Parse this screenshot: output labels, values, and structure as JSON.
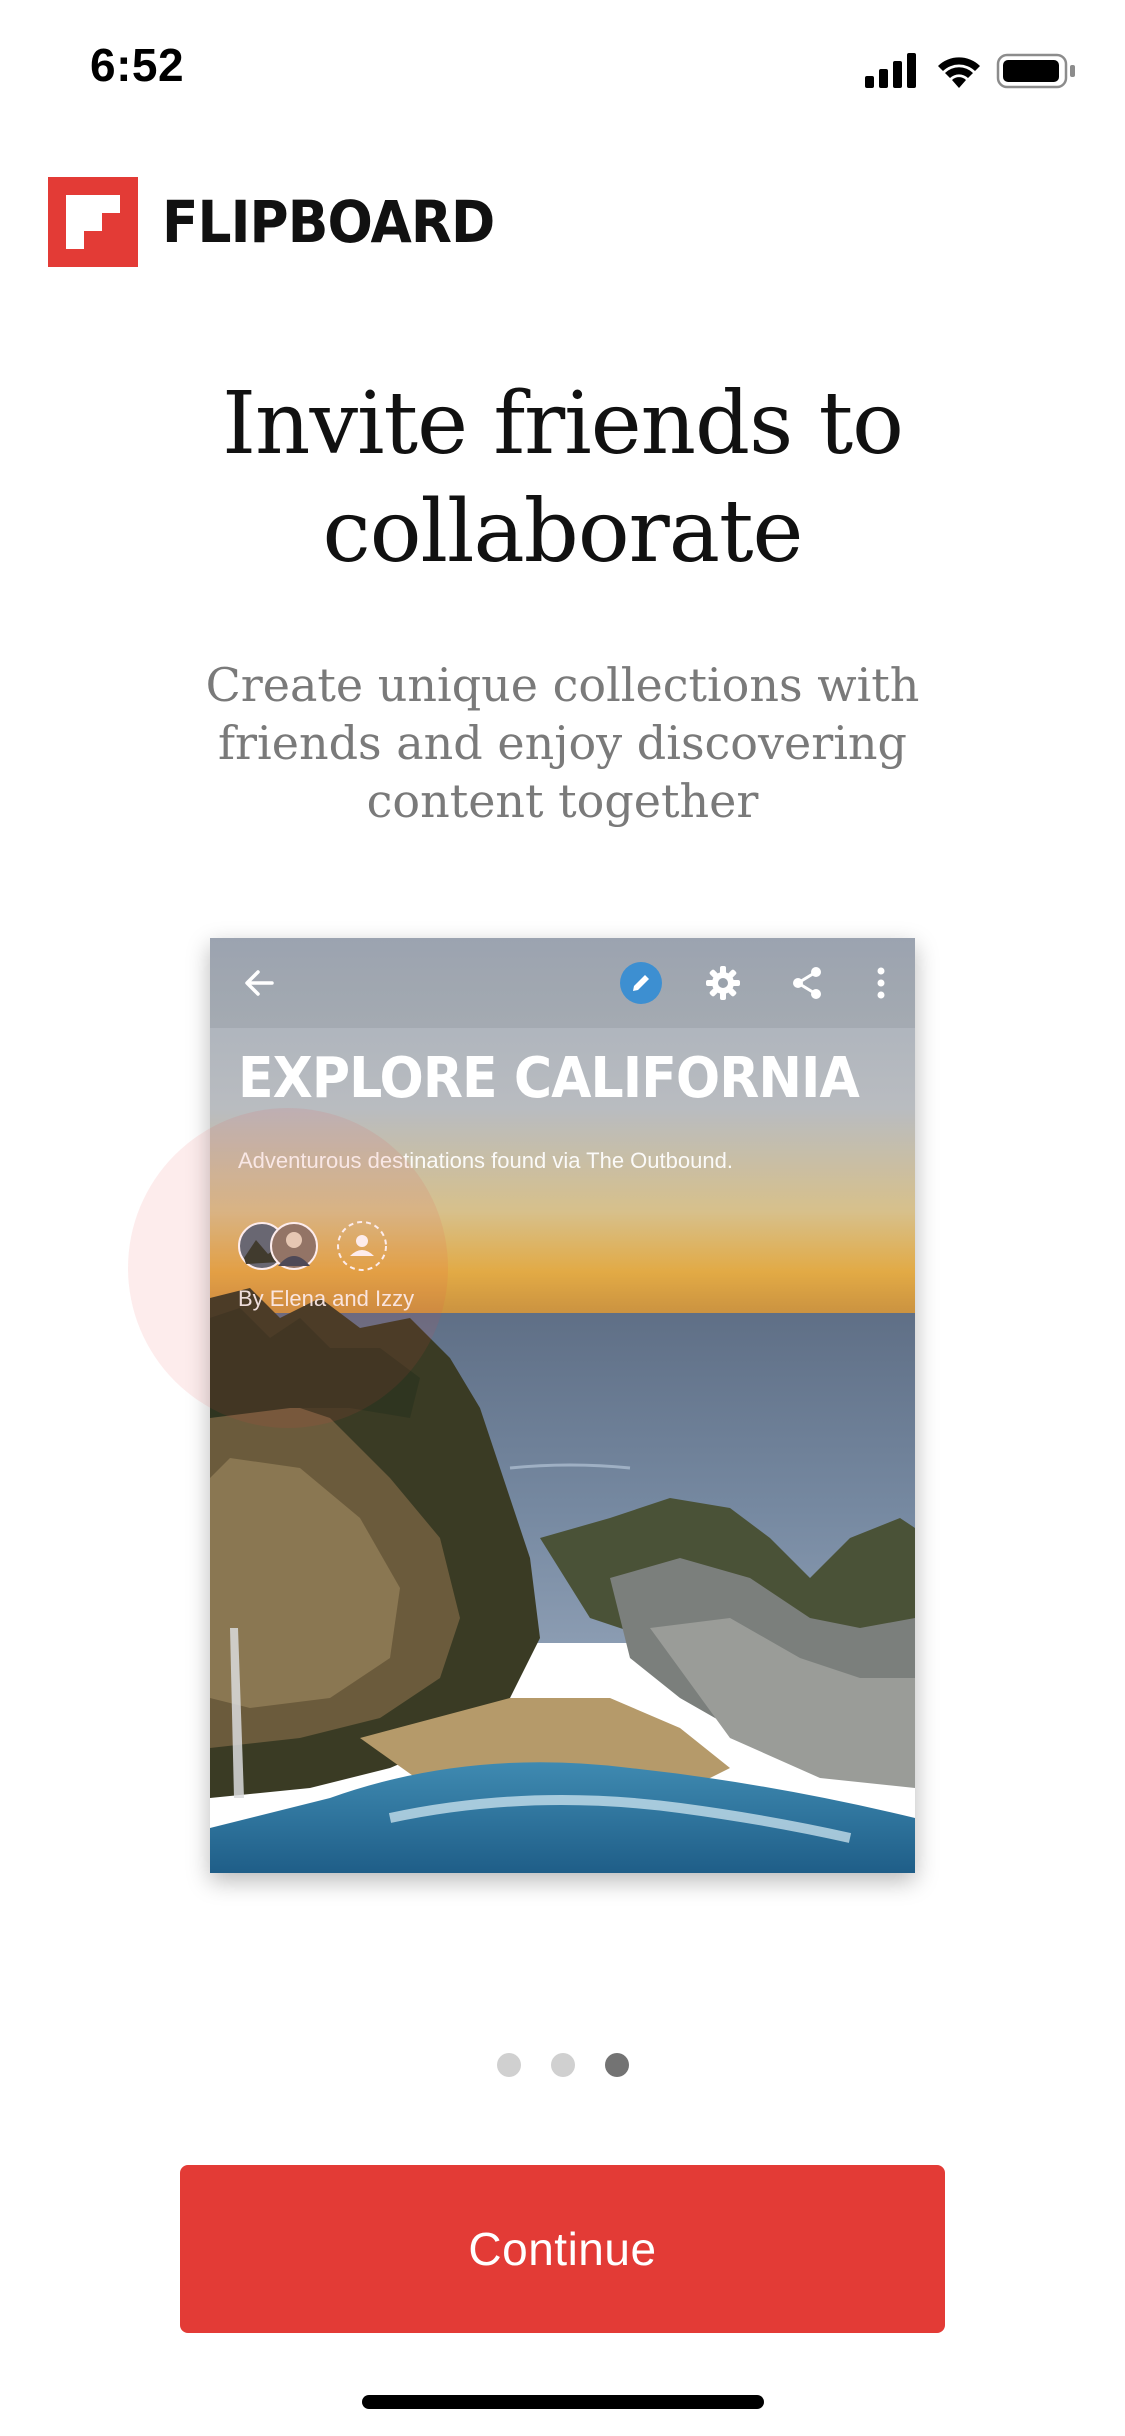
{
  "status_bar": {
    "time": "6:52",
    "icons": [
      "cellular-signal-icon",
      "wifi-icon",
      "battery-icon"
    ]
  },
  "brand": {
    "name": "FLIPBOARD",
    "color": "#e33b36"
  },
  "onboarding": {
    "title_lines": [
      "Invite friends to",
      "collaborate"
    ],
    "subtitle_lines": [
      "Create unique collections with",
      "friends and enjoy discovering",
      "content together"
    ]
  },
  "preview": {
    "title": "EXPLORE CALIFORNIA",
    "description": "Adventurous destinations found via The Outbound.",
    "byline": "By Elena and Izzy",
    "toolbar_icons": [
      "back-arrow-icon",
      "edit-pencil-icon",
      "gear-icon",
      "share-icon",
      "more-vertical-icon"
    ],
    "edit_accent": "#3d8fd1"
  },
  "pager": {
    "pages": 3,
    "active_index": 2
  },
  "actions": {
    "continue_label": "Continue",
    "continue_color": "#e33b36"
  }
}
